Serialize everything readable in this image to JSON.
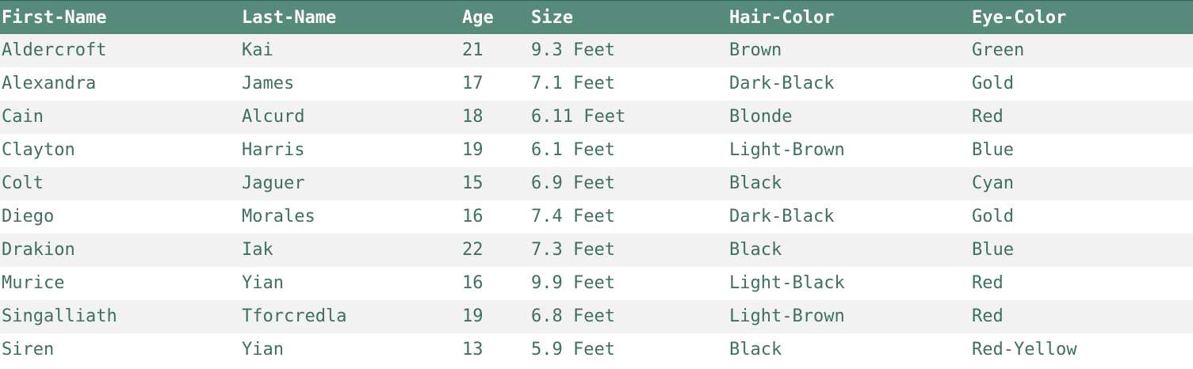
{
  "table": {
    "headers": [
      "First-Name",
      "Last-Name",
      "Age",
      "Size",
      "Hair-Color",
      "Eye-Color"
    ],
    "rows": [
      [
        "Aldercroft",
        "Kai",
        "21",
        "9.3 Feet",
        "Brown",
        "Green"
      ],
      [
        "Alexandra",
        "James",
        "17",
        "7.1 Feet",
        "Dark-Black",
        "Gold"
      ],
      [
        "Cain",
        "Alcurd",
        "18",
        "6.11 Feet",
        "Blonde",
        "Red"
      ],
      [
        "Clayton",
        "Harris",
        "19",
        "6.1 Feet",
        "Light-Brown",
        "Blue"
      ],
      [
        "Colt",
        "Jaguer",
        "15",
        "6.9 Feet",
        "Black",
        "Cyan"
      ],
      [
        "Diego",
        "Morales",
        "16",
        "7.4 Feet",
        "Dark-Black",
        "Gold"
      ],
      [
        "Drakion",
        "Iak",
        "22",
        "7.3 Feet",
        "Black",
        "Blue"
      ],
      [
        "Murice",
        "Yian",
        "16",
        "9.9 Feet",
        "Light-Black",
        "Red"
      ],
      [
        "Singalliath",
        "Tforcredla",
        "19",
        "6.8 Feet",
        "Light-Brown",
        "Red"
      ],
      [
        "Siren",
        "Yian",
        "13",
        "5.9 Feet",
        "Black",
        "Red-Yellow"
      ]
    ]
  },
  "colors": {
    "header_bg": "#568b7b",
    "header_text": "#ffffff",
    "row_text": "#3f6f61",
    "stripe_bg": "#f2f2f2"
  }
}
